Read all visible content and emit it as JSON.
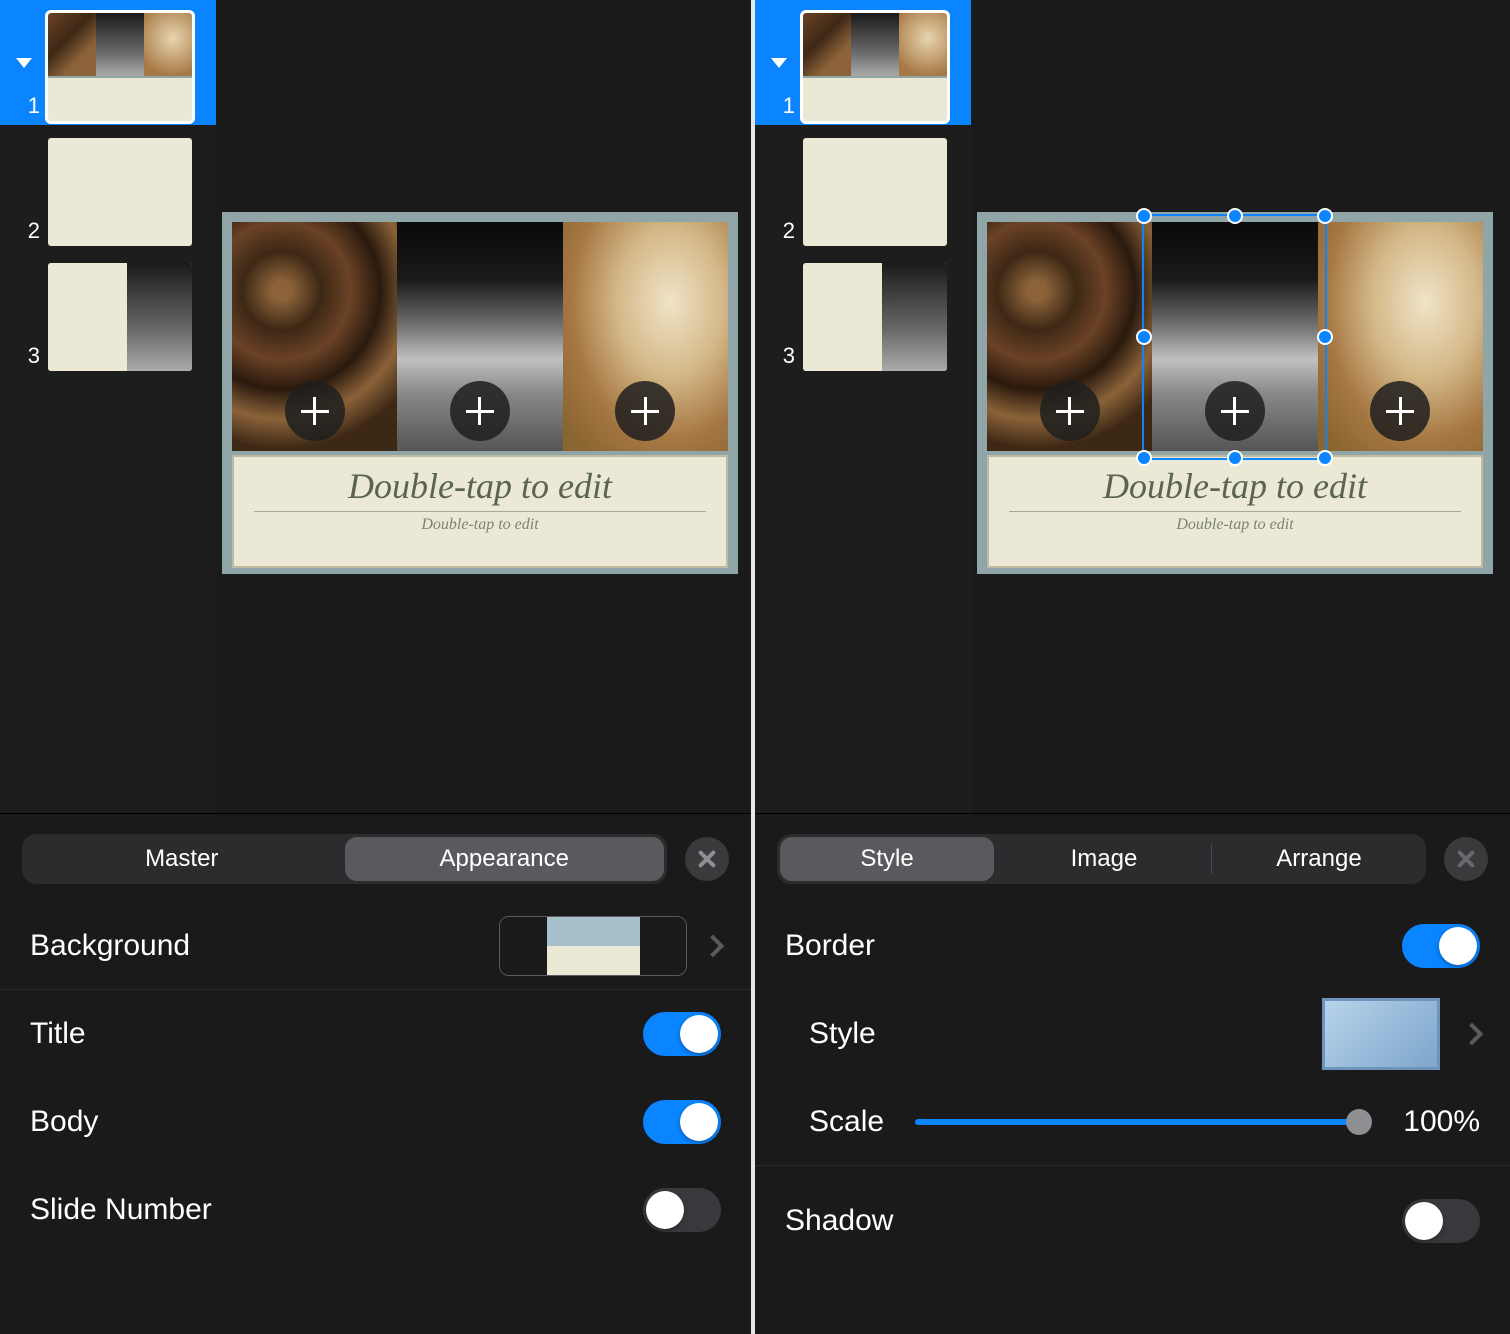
{
  "left": {
    "slides": [
      1,
      2,
      3
    ],
    "title": "Double-tap to edit",
    "subtitle": "Double-tap to edit",
    "tabs": {
      "master": "Master",
      "appearance": "Appearance"
    },
    "background": "Background",
    "titleRow": "Title",
    "bodyRow": "Body",
    "slideNumber": "Slide Number",
    "titleOn": true,
    "bodyOn": true,
    "slideNumberOn": false
  },
  "right": {
    "slides": [
      1,
      2,
      3
    ],
    "title": "Double-tap to edit",
    "subtitle": "Double-tap to edit",
    "tabs": {
      "style": "Style",
      "image": "Image",
      "arrange": "Arrange"
    },
    "border": "Border",
    "styleRow": "Style",
    "scale": "Scale",
    "scaleValue": "100%",
    "shadow": "Shadow",
    "borderOn": true,
    "shadowOn": false
  }
}
